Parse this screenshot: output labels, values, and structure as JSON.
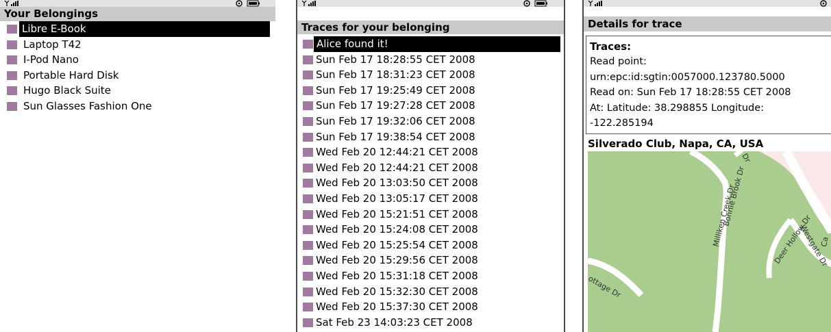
{
  "screens": {
    "belongings": {
      "title": "Your Belongings",
      "items": [
        {
          "label": "Libre E-Book",
          "selected": true
        },
        {
          "label": "Laptop T42"
        },
        {
          "label": "I-Pod Nano"
        },
        {
          "label": "Portable Hard Disk"
        },
        {
          "label": "Hugo Black Suite"
        },
        {
          "label": "Sun Glasses Fashion One"
        }
      ]
    },
    "traces": {
      "title": "Traces for your belonging",
      "items": [
        {
          "label": "Alice found it!",
          "selected": true
        },
        {
          "label": "Sun Feb 17 18:28:55 CET 2008"
        },
        {
          "label": "Sun Feb 17 18:31:23 CET 2008"
        },
        {
          "label": "Sun Feb 17 19:25:49 CET 2008"
        },
        {
          "label": "Sun Feb 17 19:27:28 CET 2008"
        },
        {
          "label": "Sun Feb 17 19:32:06 CET 2008"
        },
        {
          "label": "Sun Feb 17 19:38:54 CET 2008"
        },
        {
          "label": "Wed Feb 20 12:44:21 CET 2008"
        },
        {
          "label": "Wed Feb 20 12:44:21 CET 2008"
        },
        {
          "label": "Wed Feb 20 13:03:50 CET 2008"
        },
        {
          "label": "Wed Feb 20 13:05:17 CET 2008"
        },
        {
          "label": "Wed Feb 20 15:21:51 CET 2008"
        },
        {
          "label": "Wed Feb 20 15:24:08 CET 2008"
        },
        {
          "label": "Wed Feb 20 15:25:54 CET 2008"
        },
        {
          "label": "Wed Feb 20 15:29:56 CET 2008"
        },
        {
          "label": "Wed Feb 20 15:31:18 CET 2008"
        },
        {
          "label": "Wed Feb 20 15:32:30 CET 2008"
        },
        {
          "label": "Wed Feb 20 15:37:30 CET 2008"
        },
        {
          "label": "Sat Feb 23 14:03:23 CET 2008"
        }
      ]
    },
    "details": {
      "title": "Details for trace",
      "heading": "Traces:",
      "lines": [
        "Read point:",
        "urn:epc:id:sgtin:0057000.123780.5000",
        "Read on: Sun Feb 17 18:28:55 CET 2008",
        "At: Latitude: 38.298855 Longitude:",
        "-122.285194"
      ],
      "map_title": "Silverado Club, Napa, CA, USA",
      "streets": [
        "Milliken Creek Dr",
        "Bonnie Brook Dr",
        "Deer Hollow Dr",
        "Westgate Dr",
        "ottage Dr",
        "Dr",
        "Ca"
      ]
    }
  },
  "icons": {
    "signal": "signal-strength-icon",
    "settings": "settings-gear-icon",
    "battery": "battery-icon"
  },
  "colors": {
    "bullet": "#a07aa0",
    "titlebar": "#c9c9c9",
    "selection": "#000000",
    "map_green": "#a8cd8e",
    "map_road": "#ffffff",
    "map_pink": "#fbe9e9"
  }
}
